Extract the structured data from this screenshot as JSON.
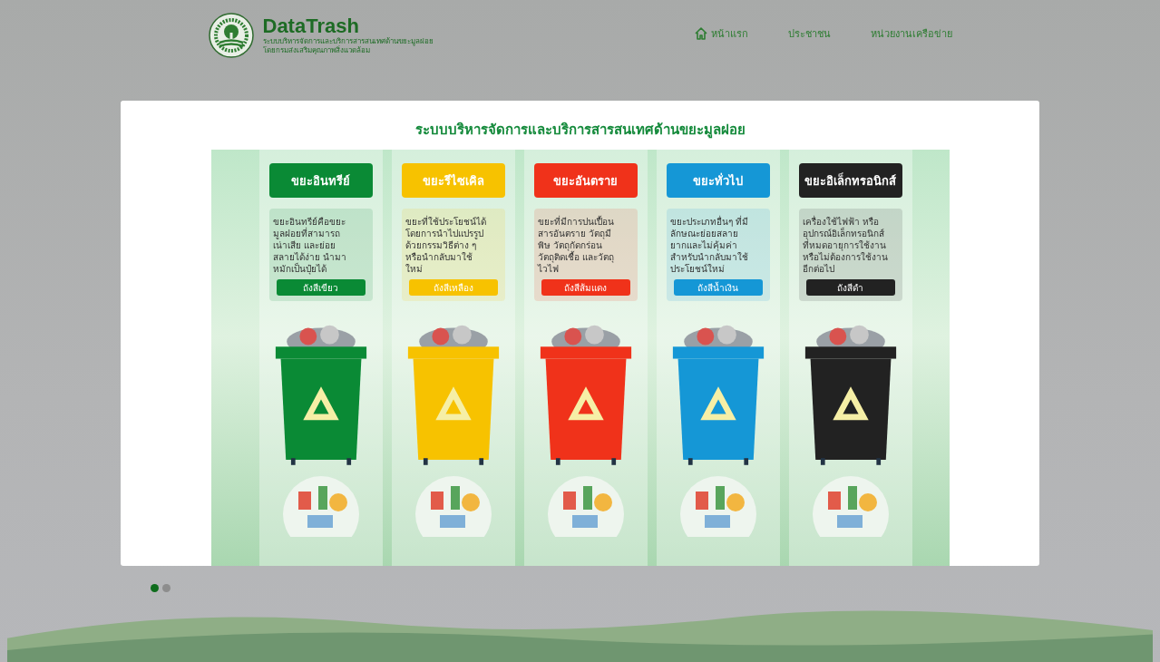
{
  "header": {
    "brand": "DataTrash",
    "subtitle_lines": [
      "ระบบบริหารจัดการและบริการสารสนเทศด้านขยะมูลฝอย",
      "โดยกรมส่งเสริมคุณภาพสิ่งแวดล้อม"
    ]
  },
  "nav": [
    {
      "label": "หน้าแรก",
      "kind": "home"
    },
    {
      "label": "ประชาชน",
      "kind": "plain"
    },
    {
      "label": "หน่วยงานเครือข่าย",
      "kind": "plain"
    }
  ],
  "slide": {
    "title": "ระบบบริหารจัดการและบริการสารสนเทศด้านขยะมูลฝอย",
    "categories": [
      {
        "name": "ขยะอินทรีย์",
        "color": "#0a8a35",
        "description": [
          "ขยะอินทรีย์คือขยะ",
          "มูลฝอยที่สามารถ",
          "เน่าเสีย และย่อย",
          "สลายได้ง่าย นำมา",
          "หมักเป็นปุ๋ยได้"
        ],
        "bin_label": "ถังสีเขียว"
      },
      {
        "name": "ขยะรีไซเคิล",
        "color": "#f7c200",
        "description": [
          "ขยะที่ใช้ประโยชน์ได้",
          "โดยการนำไปแปรรูป",
          "ด้วยกรรมวิธีต่าง ๆ",
          "หรือนำกลับมาใช้",
          "ใหม่"
        ],
        "bin_label": "ถังสีเหลือง"
      },
      {
        "name": "ขยะอันตราย",
        "color": "#f0321a",
        "description": [
          "ขยะที่มีการปนเปื้อน",
          "สารอันตราย วัตถุมี",
          "พิษ วัตถุกัดกร่อน",
          "วัตถุติดเชื้อ และวัตถุ",
          "ไวไฟ"
        ],
        "bin_label": "ถังสีส้มแดง"
      },
      {
        "name": "ขยะทั่วไป",
        "color": "#1597d6",
        "description": [
          "ขยะประเภทอื่นๆ ที่มี",
          "ลักษณะย่อยสลาย",
          "ยากและไม่คุ้มค่า",
          "สำหรับนำกลับมาใช้",
          "ประโยชน์ใหม่"
        ],
        "bin_label": "ถังสีน้ำเงิน"
      },
      {
        "name": "ขยะอิเล็กทรอนิกส์",
        "color": "#222222",
        "description": [
          "เครื่องใช้ไฟฟ้า หรือ",
          "อุปกรณ์อิเล็กทรอนิกส์",
          "ที่หมดอายุการใช้งาน",
          "หรือไม่ต้องการใช้งาน",
          "อีกต่อไป"
        ],
        "bin_label": "ถังสีดำ"
      }
    ]
  },
  "carousel_dots": [
    {
      "selected": true
    },
    {
      "selected": false
    }
  ]
}
